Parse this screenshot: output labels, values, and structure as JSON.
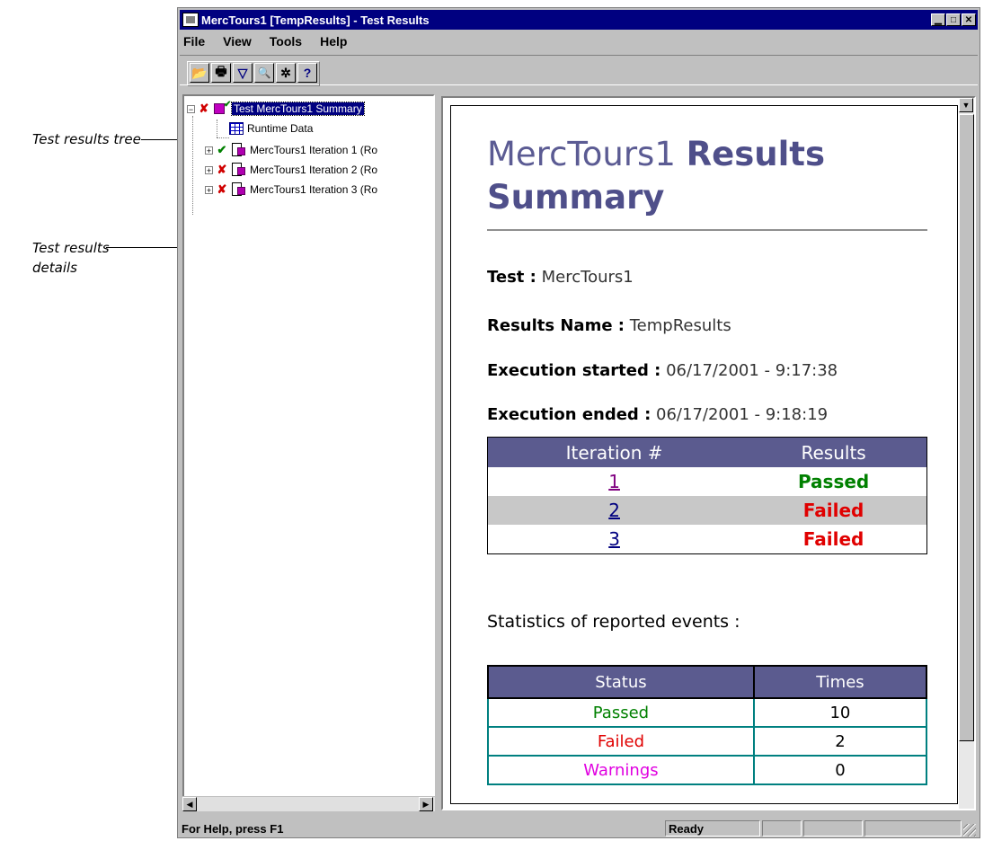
{
  "callouts": {
    "tree": "Test results tree",
    "details_line1": "Test results",
    "details_line2": "details"
  },
  "window": {
    "title": "MercTours1 [TempResults] - Test Results",
    "controls": [
      "minimize",
      "maximize",
      "close"
    ]
  },
  "menu": [
    "File",
    "View",
    "Tools",
    "Help"
  ],
  "toolbar": {
    "buttons": [
      {
        "icon": "open-folder-icon",
        "glyph": "📂"
      },
      {
        "icon": "print-icon",
        "glyph": "🖶"
      },
      {
        "icon": "filter-icon",
        "glyph": "▽"
      },
      {
        "icon": "find-icon",
        "glyph": "🔍"
      },
      {
        "icon": "debug-icon",
        "glyph": "✲"
      },
      {
        "icon": "help-icon",
        "glyph": "?"
      }
    ]
  },
  "tree": {
    "root": {
      "label": "Test MercTours1 Summary",
      "status": "failed",
      "expander": "−"
    },
    "runtime": {
      "label": "Runtime Data"
    },
    "iterations": [
      {
        "label": "MercTours1 Iteration 1 (Ro",
        "status": "passed",
        "expander": "+"
      },
      {
        "label": "MercTours1 Iteration 2 (Ro",
        "status": "failed",
        "expander": "+"
      },
      {
        "label": "MercTours1 Iteration 3 (Ro",
        "status": "failed",
        "expander": "+"
      }
    ],
    "status_glyphs": {
      "passed": "✔",
      "failed": "✘"
    },
    "status_colors": {
      "passed": "#008000",
      "failed": "#d00000"
    }
  },
  "details": {
    "title_name": "MercTours1",
    "title_bold": "Results Summary",
    "test_label": "Test :",
    "test_value": "MercTours1",
    "results_name_label": "Results Name :",
    "results_name_value": "TempResults",
    "exec_started_label": "Execution started :",
    "exec_started_value": "06/17/2001 - 9:17:38",
    "exec_ended_label": "Execution ended :",
    "exec_ended_value": "06/17/2001 - 9:18:19",
    "iteration_table": {
      "headers": [
        "Iteration #",
        "Results"
      ],
      "rows": [
        {
          "iteration": "1",
          "result": "Passed"
        },
        {
          "iteration": "2",
          "result": "Failed"
        },
        {
          "iteration": "3",
          "result": "Failed"
        }
      ]
    },
    "stats_heading": "Statistics of reported events :",
    "stats_table": {
      "headers": [
        "Status",
        "Times"
      ],
      "rows": [
        {
          "status": "Passed",
          "times": "10"
        },
        {
          "status": "Failed",
          "times": "2"
        },
        {
          "status": "Warnings",
          "times": "0"
        }
      ]
    }
  },
  "statusbar": {
    "help": "For Help, press F1",
    "state": "Ready"
  },
  "colors": {
    "titlebar": "#000080",
    "table_header": "#5b5b8f",
    "passed": "#008000",
    "failed": "#e00000",
    "warnings": "#e000e0"
  }
}
